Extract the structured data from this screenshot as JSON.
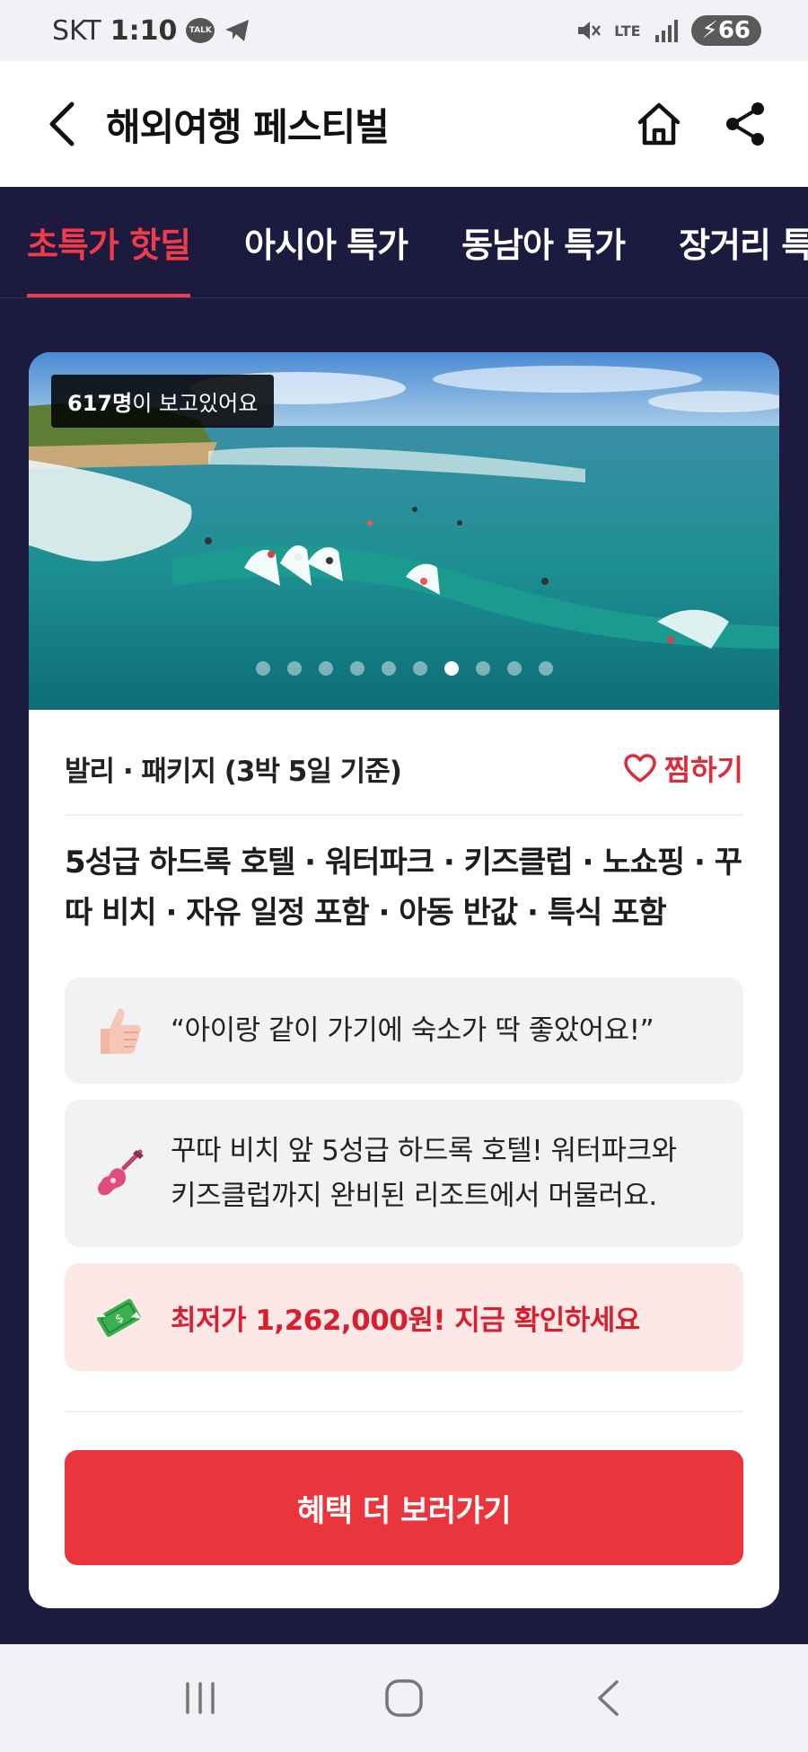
{
  "status_bar": {
    "carrier": "SKT",
    "time": "1:10",
    "talk_badge": "TALK",
    "network": "LTE",
    "battery": "66"
  },
  "header": {
    "title": "해외여행 페스티벌"
  },
  "tabs": [
    {
      "label": "초특가 핫딜",
      "active": true
    },
    {
      "label": "아시아 특가",
      "active": false
    },
    {
      "label": "동남아 특가",
      "active": false
    },
    {
      "label": "장거리 특가",
      "active": false
    }
  ],
  "card": {
    "viewers_count": "617명",
    "viewers_suffix": "이 보고있어요",
    "carousel": {
      "total": 10,
      "active_index": 6
    },
    "product_title": "발리 · 패키지 (3박 5일 기준)",
    "wish_label": "찜하기",
    "description_line1": "5성급 하드록 호텔 · 워터파크 · 키즈클럽 · 노쇼핑 · 꾸",
    "description_line2": "따 비치 · 자유 일정 포함 · 아동 반값 · 특식 포함",
    "review_quote": "“아이랑 같이 가기에 숙소가 딱 좋았어요!”",
    "feature_line1": "꾸따 비치 앞 5성급 하드록 호텔! 워터파크와",
    "feature_line2": "키즈클럽까지 완비된 리조트에서 머물러요.",
    "price_text": "최저가 1,262,000원! 지금 확인하세요",
    "cta_label": "혜택 더 보러가기"
  },
  "icons": {
    "review": "thumbs-up-icon",
    "feature": "guitar-icon",
    "price": "money-icon"
  },
  "colors": {
    "accent": "#ea353c",
    "background": "#1c1a3e",
    "price_bg": "#fde8e8"
  }
}
